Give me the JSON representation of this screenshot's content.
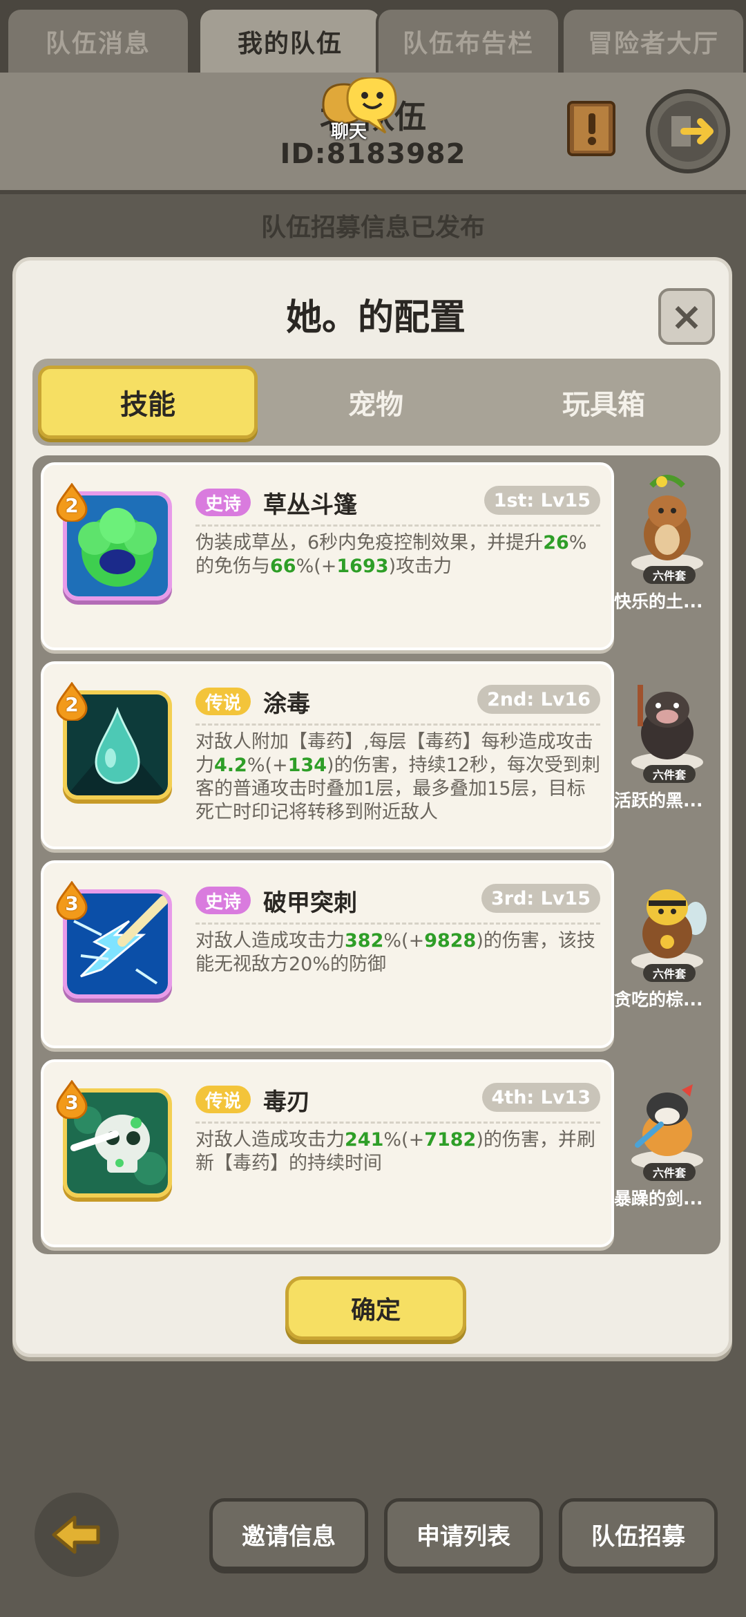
{
  "top_tabs": [
    {
      "label": "队伍消息",
      "active": false
    },
    {
      "label": "我的队伍",
      "active": true
    },
    {
      "label": "队伍布告栏",
      "active": false
    },
    {
      "label": "冒险者大厅",
      "active": false
    }
  ],
  "team": {
    "name": "北    队伍",
    "id": "ID:8183982",
    "chat_label": "聊天",
    "recruit_status": "队伍招募信息已发布"
  },
  "modal": {
    "title": "她。的配置",
    "close_symbol": "×",
    "sub_tabs": [
      {
        "label": "技能",
        "active": true
      },
      {
        "label": "宠物",
        "active": false
      },
      {
        "label": "玩具箱",
        "active": false
      }
    ],
    "skills": [
      {
        "level": "2",
        "rarity": "史诗",
        "rarity_type": "epic",
        "name": "草丛斗篷",
        "slot": "1st: Lv15",
        "icon": "bush-cloak-icon",
        "desc": [
          {
            "t": "伪装成草丛，6秒内免疫控制效果，并提升"
          },
          {
            "t": "26",
            "hl": true
          },
          {
            "t": "%的免伤与"
          },
          {
            "t": "66",
            "hl": true
          },
          {
            "t": "%(+"
          },
          {
            "t": "1693",
            "hl": true
          },
          {
            "t": ")攻击力"
          }
        ]
      },
      {
        "level": "2",
        "rarity": "传说",
        "rarity_type": "legend",
        "name": "涂毒",
        "slot": "2nd: Lv16",
        "icon": "poison-drop-icon",
        "desc": [
          {
            "t": "对敌人附加【毒药】,每层【毒药】每秒造成攻击力"
          },
          {
            "t": "4.2",
            "hl": true
          },
          {
            "t": "%(+"
          },
          {
            "t": "134",
            "hl": true
          },
          {
            "t": ")的伤害，持续12秒，每次受到刺客的普通攻击时叠加1层，最多叠加15层，目标死亡时印记将转移到附近敌人"
          }
        ]
      },
      {
        "level": "3",
        "rarity": "史诗",
        "rarity_type": "epic",
        "name": "破甲突刺",
        "slot": "3rd: Lv15",
        "icon": "armor-pierce-icon",
        "desc": [
          {
            "t": "对敌人造成攻击力"
          },
          {
            "t": "382",
            "hl": true
          },
          {
            "t": "%(+"
          },
          {
            "t": "9828",
            "hl": true
          },
          {
            "t": ")的伤害，该技能无视敌方20%的防御"
          }
        ]
      },
      {
        "level": "3",
        "rarity": "传说",
        "rarity_type": "legend",
        "name": "毒刃",
        "slot": "4th: Lv13",
        "icon": "poison-blade-skull-icon",
        "desc": [
          {
            "t": "对敌人造成攻击力"
          },
          {
            "t": "241",
            "hl": true
          },
          {
            "t": "%(+"
          },
          {
            "t": "7182",
            "hl": true
          },
          {
            "t": ")的伤害，并刷新【毒药】的持续时间"
          }
        ]
      }
    ],
    "pets": [
      {
        "name": "快乐的土...",
        "set_label": "六件套",
        "icon": "squirrel-pet-icon"
      },
      {
        "name": "活跃的黑...",
        "set_label": "六件套",
        "icon": "boar-pet-icon"
      },
      {
        "name": "贪吃的棕...",
        "set_label": "六件套",
        "icon": "bee-bear-pet-icon"
      },
      {
        "name": "暴躁的剑...",
        "set_label": "六件套",
        "icon": "cat-swordsman-pet-icon"
      }
    ],
    "confirm_label": "确定"
  },
  "bottom_bar": {
    "invite_label": "邀请信息",
    "apply_label": "申请列表",
    "recruit_label": "队伍招募"
  },
  "colors": {
    "accent_yellow": "#f6df63",
    "epic_purple": "#d97bde",
    "legend_gold": "#f3c43a",
    "highlight_green": "#2e9e27"
  }
}
